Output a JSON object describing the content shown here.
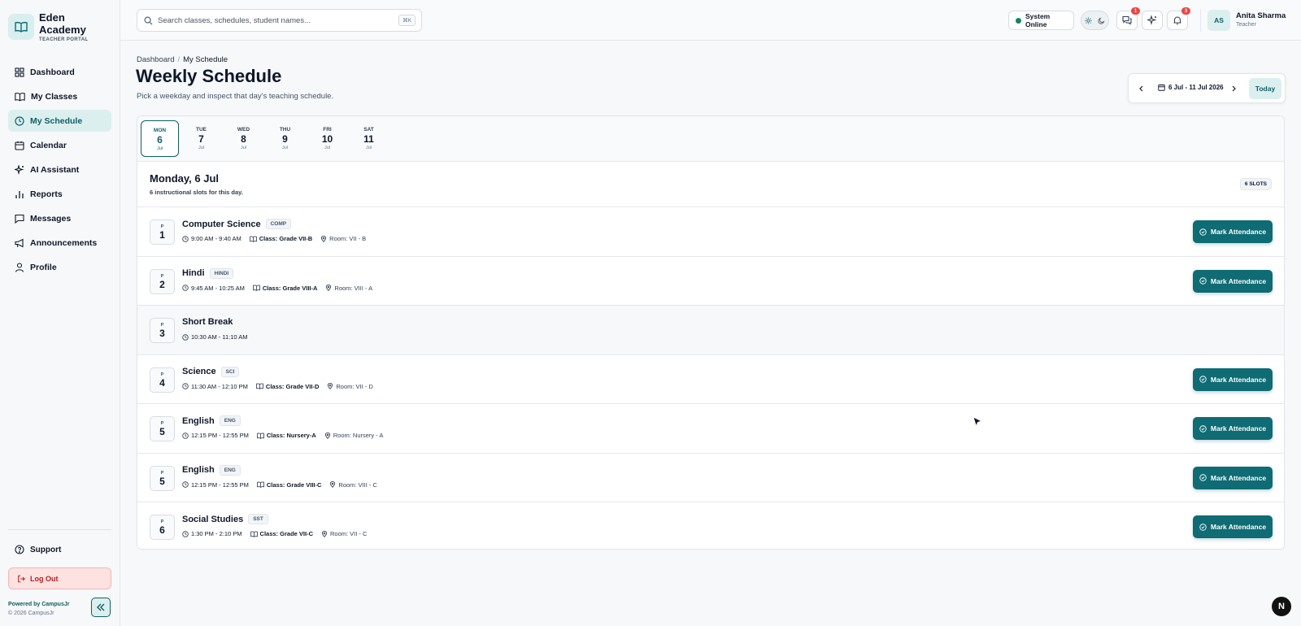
{
  "brand": {
    "name_line1": "Eden",
    "name_line2": "Academy",
    "subtitle": "TEACHER PORTAL",
    "icon": "open-book-icon"
  },
  "sidebar": {
    "items": [
      {
        "label": "Dashboard",
        "icon": "grid-icon",
        "active": false
      },
      {
        "label": "My Classes",
        "icon": "book-icon",
        "active": false
      },
      {
        "label": "My Schedule",
        "icon": "clock-icon",
        "active": true
      },
      {
        "label": "Calendar",
        "icon": "calendar-icon",
        "active": false
      },
      {
        "label": "AI Assistant",
        "icon": "sparkle-icon",
        "active": false
      },
      {
        "label": "Reports",
        "icon": "bar-chart-icon",
        "active": false
      },
      {
        "label": "Messages",
        "icon": "message-icon",
        "active": false
      },
      {
        "label": "Announcements",
        "icon": "megaphone-icon",
        "active": false
      },
      {
        "label": "Profile",
        "icon": "user-icon",
        "active": false
      }
    ],
    "support": "Support",
    "logout": "Log Out",
    "powered_by": "Powered by CampusJr",
    "copyright": "© 2026 CampusJr"
  },
  "header": {
    "search_placeholder": "Search classes, schedules, student names...",
    "search_shortcut": "⌘K",
    "status": "System Online",
    "messages_badge": "1",
    "notifications_badge": "3",
    "user": {
      "initials": "AS",
      "name": "Anita Sharma",
      "role": "Teacher"
    }
  },
  "page": {
    "breadcrumb_root": "Dashboard",
    "breadcrumb_sep": "/",
    "breadcrumb_current": "My Schedule",
    "title": "Weekly Schedule",
    "subtitle": "Pick a weekday and inspect that day's teaching schedule."
  },
  "week_nav": {
    "range": "6 Jul - 11 Jul 2026",
    "today": "Today"
  },
  "days": [
    {
      "name": "MON",
      "num": "6",
      "month": "Jul",
      "active": true
    },
    {
      "name": "TUE",
      "num": "7",
      "month": "Jul",
      "active": false
    },
    {
      "name": "WED",
      "num": "8",
      "month": "Jul",
      "active": false
    },
    {
      "name": "THU",
      "num": "9",
      "month": "Jul",
      "active": false
    },
    {
      "name": "FRI",
      "num": "10",
      "month": "Jul",
      "active": false
    },
    {
      "name": "SAT",
      "num": "11",
      "month": "Jul",
      "active": false
    }
  ],
  "selected_day": {
    "title": "Monday, 6 Jul",
    "summary": "6 instructional slots for this day.",
    "slots_badge": "6 SLOTS"
  },
  "slots": [
    {
      "period_label": "P",
      "period": "1",
      "subject": "Computer Science",
      "code": "COMP",
      "time": "9:00 AM - 9:40 AM",
      "class_label": "Class:",
      "class": "Grade VII-B",
      "room": "Room: VII - B",
      "action": "Mark Attendance",
      "is_break": false
    },
    {
      "period_label": "P",
      "period": "2",
      "subject": "Hindi",
      "code": "HINDI",
      "time": "9:45 AM - 10:25 AM",
      "class_label": "Class:",
      "class": "Grade VIII-A",
      "room": "Room: VIII - A",
      "action": "Mark Attendance",
      "is_break": false
    },
    {
      "period_label": "P",
      "period": "3",
      "subject": "Short Break",
      "code": "",
      "time": "10:30 AM - 11:10 AM",
      "class_label": "",
      "class": "",
      "room": "",
      "action": "",
      "is_break": true
    },
    {
      "period_label": "P",
      "period": "4",
      "subject": "Science",
      "code": "SCI",
      "time": "11:30 AM - 12:10 PM",
      "class_label": "Class:",
      "class": "Grade VII-D",
      "room": "Room: VII - D",
      "action": "Mark Attendance",
      "is_break": false
    },
    {
      "period_label": "P",
      "period": "5",
      "subject": "English",
      "code": "ENG",
      "time": "12:15 PM - 12:55 PM",
      "class_label": "Class:",
      "class": "Nursery-A",
      "room": "Room: Nursery - A",
      "action": "Mark Attendance",
      "is_break": false
    },
    {
      "period_label": "P",
      "period": "5",
      "subject": "English",
      "code": "ENG",
      "time": "12:15 PM - 12:55 PM",
      "class_label": "Class:",
      "class": "Grade VIII-C",
      "room": "Room: VIII - C",
      "action": "Mark Attendance",
      "is_break": false
    },
    {
      "period_label": "P",
      "period": "6",
      "subject": "Social Studies",
      "code": "SST",
      "time": "1:30 PM - 2:10 PM",
      "class_label": "Class:",
      "class": "Grade VII-C",
      "room": "Room: VII - C",
      "action": "Mark Attendance",
      "is_break": false
    }
  ],
  "floating_badge": "N",
  "colors": {
    "accent": "#0f6b74",
    "accent_soft": "#dcefef",
    "danger": "#b91c1c",
    "online": "#10855f",
    "badge": "#ef4444"
  }
}
